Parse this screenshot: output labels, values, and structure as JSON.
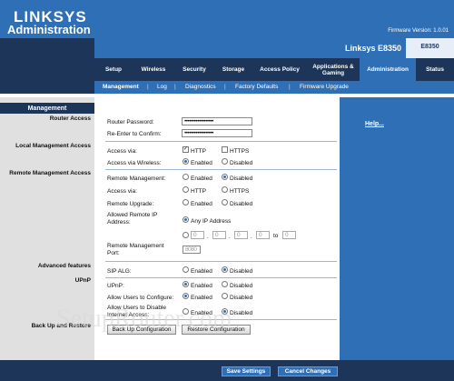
{
  "header": {
    "logo": "LINKSYS",
    "firmware": "Firmware Version: 1.0.01"
  },
  "page_title": "Administration",
  "model": {
    "name": "Linksys E8350",
    "code": "E8350"
  },
  "tabs": [
    {
      "label": "Setup"
    },
    {
      "label": "Wireless"
    },
    {
      "label": "Security"
    },
    {
      "label": "Storage"
    },
    {
      "label": "Access Policy"
    },
    {
      "label": "Applications & Gaming"
    },
    {
      "label": "Administration"
    },
    {
      "label": "Status"
    }
  ],
  "subtabs": [
    {
      "label": "Management"
    },
    {
      "label": "Log"
    },
    {
      "label": "Diagnostics"
    },
    {
      "label": "Factory Defaults"
    },
    {
      "label": "Firmware Upgrade"
    }
  ],
  "subtab_separator": "|",
  "sidebar": {
    "header": "Management",
    "router_access": "Router Access",
    "local_mgmt": "Local Management Access",
    "remote_mgmt": "Remote Management Access",
    "advanced": "Advanced features",
    "upnp": "UPnP",
    "backup": "Back Up and Restore"
  },
  "help": "Help...",
  "router_access": {
    "password_label": "Router Password:",
    "password_value": "••••••••••••••••••",
    "reenter_label": "Re-Enter to  Confirm:",
    "reenter_value": "••••••••••••••••••"
  },
  "local": {
    "access_via_label": "Access via:",
    "http": "HTTP",
    "https": "HTTPS",
    "wireless_label": "Access via Wireless:",
    "enabled": "Enabled",
    "disabled": "Disabled"
  },
  "remote": {
    "mgmt_label": "Remote  Management:",
    "access_via_label": "Access via:",
    "http": "HTTP",
    "https": "HTTPS",
    "upgrade_label": "Remote Upgrade:",
    "allowed_label": "Allowed Remote IP Address:",
    "any_ip": "Any IP Address",
    "ip_values": [
      "0",
      "0",
      "0",
      "0",
      "0"
    ],
    "to": "to",
    "port_label": "Remote Management Port:",
    "port_value": "8080",
    "enabled": "Enabled",
    "disabled": "Disabled"
  },
  "advanced": {
    "sip_label": "SIP ALG:",
    "enabled": "Enabled",
    "disabled": "Disabled"
  },
  "upnp": {
    "upnp_label": "UPnP:",
    "configure_label": "Allow Users to Configure:",
    "disable_label": "Allow Users to Disable Internet Access:",
    "enabled": "Enabled",
    "disabled": "Disabled"
  },
  "backup": {
    "backup_btn": "Back Up Configuration",
    "restore_btn": "Restore Configuration"
  },
  "footer": {
    "save": "Save Settings",
    "cancel": "Cancel Changes"
  },
  "watermark": "SetupRouter.com",
  "colors": {
    "brand_blue": "#2f6fb6",
    "navy": "#1d3558",
    "panel_grey": "#e0e0e0"
  }
}
